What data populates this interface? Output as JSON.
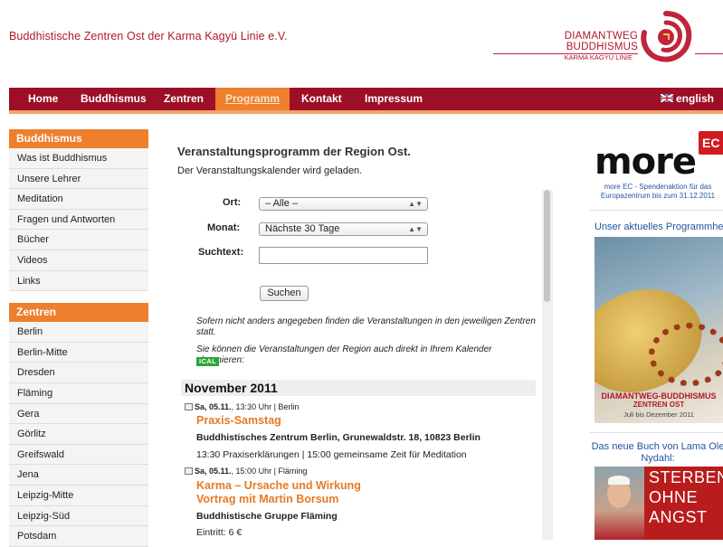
{
  "header": {
    "org_title": "Buddhistische Zentren Ost der Karma Kagyü Linie e.V.",
    "brand_name": "DIAMANTWEG BUDDHISMUS",
    "brand_sub": "KARMA KAGYÜ LINIE",
    "brand_color": "#b0182b"
  },
  "nav": {
    "items": [
      "Home",
      "Buddhismus",
      "Zentren",
      "Programm",
      "Kontakt",
      "Impressum"
    ],
    "active": "Programm",
    "language": "english",
    "bar_color": "#9d0f27",
    "active_color": "#ee7f2d"
  },
  "sidebar": {
    "section1_title": "Buddhismus",
    "section1_items": [
      "Was ist Buddhismus",
      "Unsere Lehrer",
      "Meditation",
      "Fragen und Antworten",
      "Bücher",
      "Videos",
      "Links"
    ],
    "section2_title": "Zentren",
    "section2_items": [
      "Berlin",
      "Berlin-Mitte",
      "Dresden",
      "Fläming",
      "Gera",
      "Görlitz",
      "Greifswald",
      "Jena",
      "Leipzig-Mitte",
      "Leipzig-Süd",
      "Potsdam"
    ]
  },
  "main": {
    "title": "Veranstaltungsprogramm der Region Ost.",
    "loading": "Der Veranstaltungskalender wird geladen.",
    "form": {
      "ort_label": "Ort:",
      "ort_value": "– Alle –",
      "monat_label": "Monat:",
      "monat_value": "Nächste 30 Tage",
      "suchtext_label": "Suchtext:",
      "suchtext_value": "",
      "submit": "Suchen"
    },
    "note1": "Sofern nicht anders angegeben finden die Veranstaltungen in den jeweiligen Zentren statt.",
    "note2": "Sie können die Veranstaltungen der Region auch direkt in Ihrem Kalender abonnieren:",
    "ical": "ICAL",
    "month": "November 2011",
    "events": [
      {
        "date": "Sa, 05.11.",
        "time_place": ", 13:30 Uhr | Berlin",
        "title": "Praxis-Samstag",
        "place": "Buddhistisches Zentrum Berlin, Grunewaldstr. 18, 10823 Berlin",
        "desc": "13:30 Praxiserklärungen | 15:00 gemeinsame Zeit für Meditation"
      },
      {
        "date": "Sa, 05.11.",
        "time_place": ", 15:00 Uhr | Fläming",
        "title_line1": "Karma – Ursache und Wirkung",
        "title_line2": "Vortrag mit Martin Borsum",
        "place": "Buddhistische Gruppe Fläming",
        "desc": "Eintritt: 6 €"
      }
    ]
  },
  "right": {
    "more_word": "more",
    "more_badge": "EC",
    "more_text": "more EC - Spendenaktion für das Europazentrum bis zum 31.12.2011",
    "program_heading": "Unser aktuelles Programmheft",
    "poster_line1": "DIAMANTWEG-BUDDHISMUS",
    "poster_line2": "ZENTREN OST",
    "poster_line3": "Juli bis Dezember 2011",
    "book_heading": "Das neue Buch von Lama Ole Nydahl:",
    "book_title": [
      "STERBEN",
      "OHNE",
      "ANGST"
    ]
  }
}
